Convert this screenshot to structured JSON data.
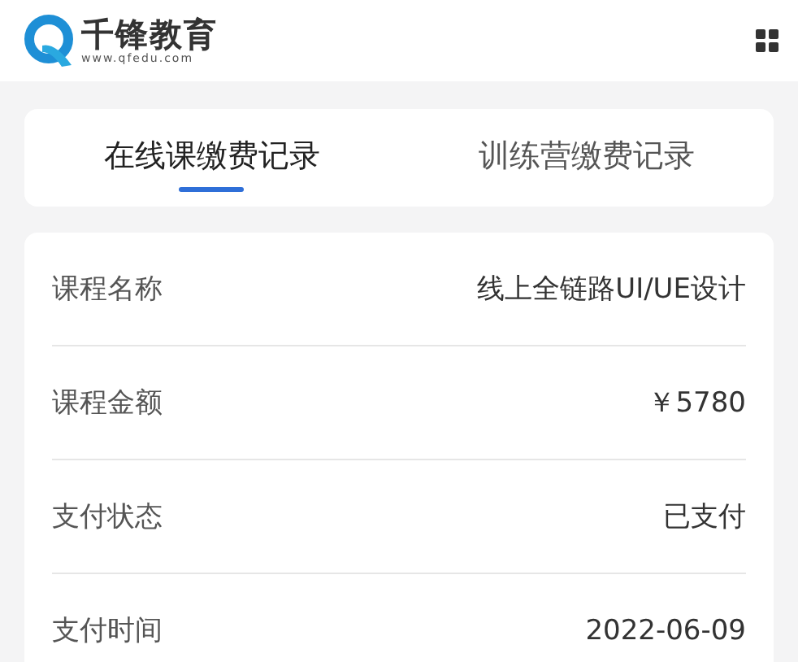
{
  "header": {
    "brand": "千锋教育",
    "url": "www.qfedu.com"
  },
  "tabs": [
    {
      "label": "在线课缴费记录",
      "selected": true
    },
    {
      "label": "训练营缴费记录",
      "selected": false
    }
  ],
  "record": [
    {
      "label": "课程名称",
      "value": "线上全链路UI/UE设计"
    },
    {
      "label": "课程金额",
      "value": "￥5780"
    },
    {
      "label": "支付状态",
      "value": "已支付"
    },
    {
      "label": "支付时间",
      "value": "2022-06-09"
    }
  ]
}
